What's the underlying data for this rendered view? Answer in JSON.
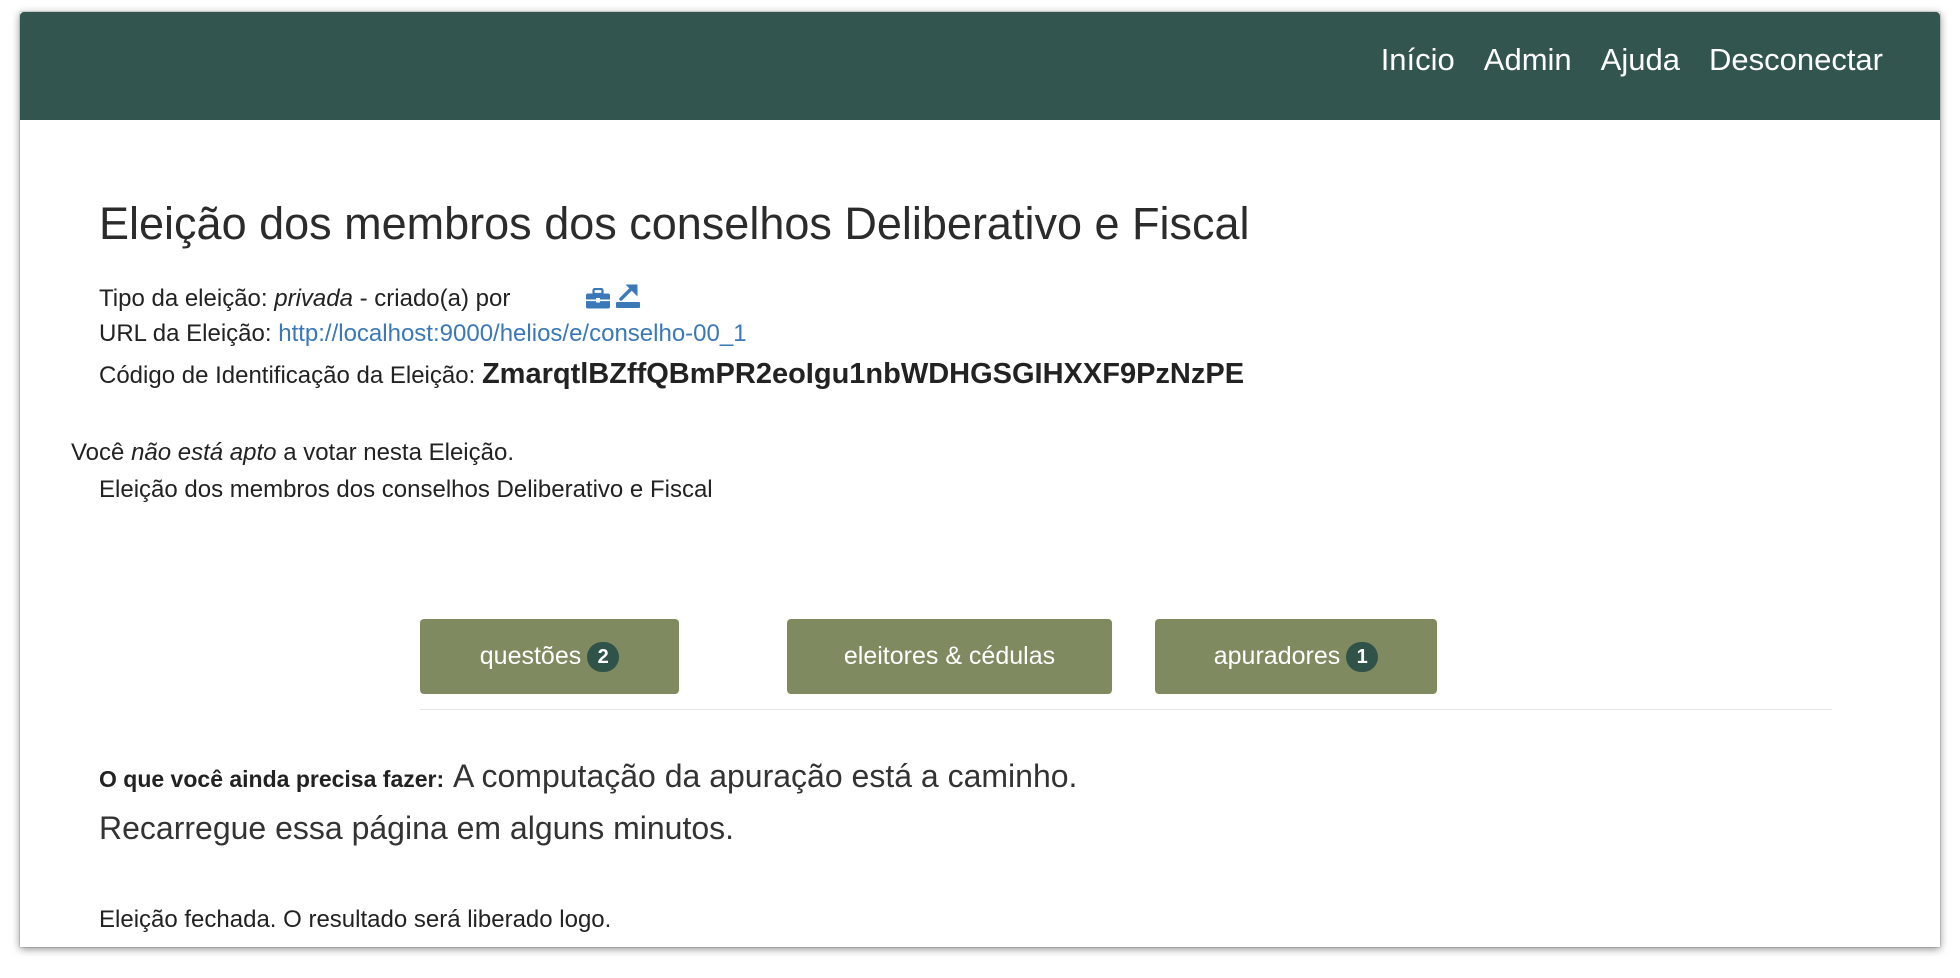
{
  "nav": {
    "items": [
      {
        "label": "Início"
      },
      {
        "label": "Admin"
      },
      {
        "label": "Ajuda"
      },
      {
        "label": "Desconectar"
      }
    ]
  },
  "election": {
    "title": "Eleição dos membros dos conselhos Deliberativo e Fiscal",
    "type_label": "Tipo da eleição:",
    "type_value": "privada",
    "created_by": "- criado(a) por",
    "url_label": "URL da Eleição:",
    "url_value": "http://localhost:9000/helios/e/conselho-00_1",
    "code_label": "Código de Identificação da Eleição:",
    "code_value": "ZmarqtlBZffQBmPR2eoIgu1nbWDHGSGIHXXF9PzNzPE",
    "eligibility_prefix": "Você",
    "eligibility_status": "não está apto",
    "eligibility_suffix": "a votar nesta Eleição.",
    "description": "Eleição dos membros dos conselhos Deliberativo e Fiscal"
  },
  "icons": {
    "briefcase": "briefcase-icon",
    "export": "export-icon"
  },
  "buttons": {
    "questions": {
      "label": "questões",
      "count": "2"
    },
    "voters": {
      "label": "eleitores & cédulas"
    },
    "trustees": {
      "label": "apuradores",
      "count": "1"
    }
  },
  "todo": {
    "label": "O que você ainda precisa fazer:",
    "line1": "A computação da apuração está a caminho.",
    "line2": "Recarregue essa página em alguns minutos."
  },
  "status": {
    "closed": "Eleição fechada. O resultado será liberado logo."
  },
  "colors": {
    "navbar": "#33554f",
    "button": "#808a60",
    "badge": "#2f5349",
    "link": "#3a78b8"
  }
}
